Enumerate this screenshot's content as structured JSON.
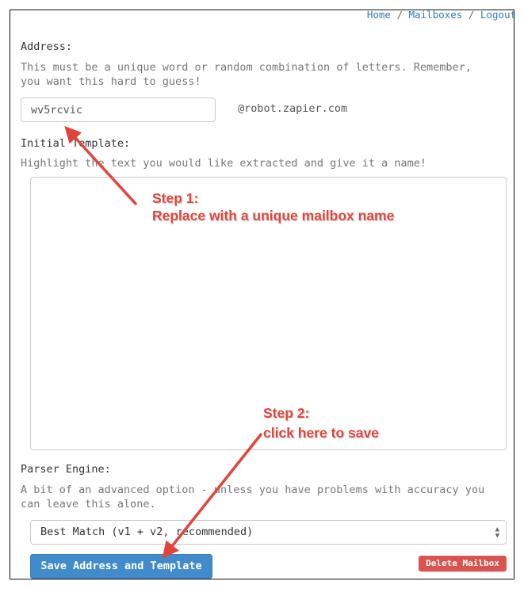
{
  "nav": {
    "home": "Home",
    "sep1": "/",
    "mailboxes": "Mailboxes",
    "sep2": "/",
    "logout": "Logout"
  },
  "address": {
    "label": "Address:",
    "help": "This must be a unique word or random combination of letters. Remember, you want this hard to guess!",
    "value": "wv5rcvic",
    "domain_suffix": "@robot.zapier.com"
  },
  "template": {
    "label": "Initial Template:",
    "help": "Highlight the text you would like extracted and give it a name!"
  },
  "parser": {
    "label": "Parser Engine:",
    "help": "A bit of an advanced option - unless you have problems with accuracy you can leave this alone.",
    "selected": "Best Match (v1 + v2, recommended)",
    "select_icon": "up-down-arrows-icon"
  },
  "buttons": {
    "save": "Save Address and Template",
    "delete": "Delete Mailbox"
  },
  "annotations": {
    "step1_title": "Step 1:",
    "step1_text": "Replace with a unique mailbox name",
    "step2_title": "Step 2:",
    "step2_text": "click here to save"
  },
  "colors": {
    "primary": "#428bca",
    "danger": "#d9534f",
    "annotation": "#e2443a",
    "link": "#337ab7"
  }
}
